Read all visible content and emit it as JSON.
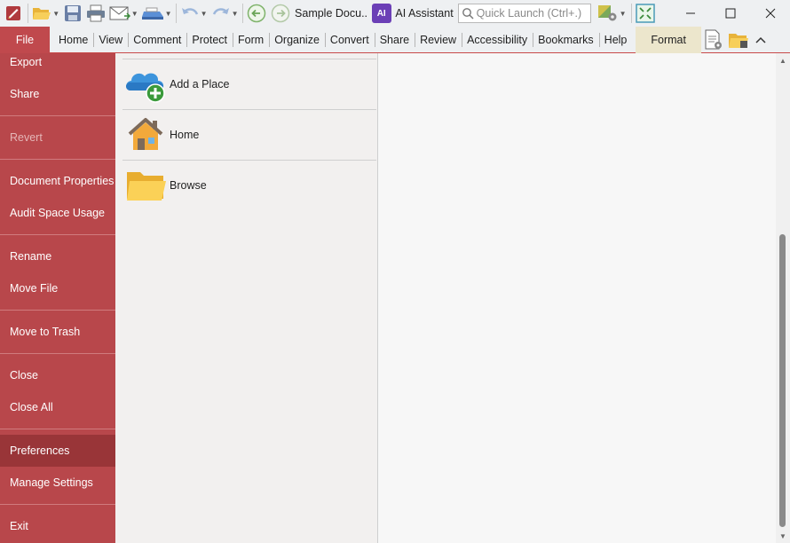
{
  "titlebar": {
    "document_title": "Sample Docu..",
    "ai_assistant_label": "AI Assistant",
    "ai_icon_text": "AI",
    "quick_launch_placeholder": "Quick Launch (Ctrl+.)",
    "icons": [
      "app-logo-icon",
      "open-folder-icon",
      "save-icon",
      "print-icon",
      "email-icon",
      "scan-icon",
      "undo-icon",
      "redo-icon",
      "back-icon",
      "forward-icon",
      "ai-assistant-icon",
      "search-icon",
      "theme-settings-icon",
      "fullscreen-icon",
      "minimize-icon",
      "maximize-icon",
      "close-icon"
    ]
  },
  "ribbon": {
    "file_tab": "File",
    "tabs": [
      "Home",
      "View",
      "Comment",
      "Protect",
      "Form",
      "Organize",
      "Convert",
      "Share",
      "Review",
      "Accessibility",
      "Bookmarks",
      "Help"
    ],
    "format_tab": "Format",
    "right_icons": [
      "document-properties-icon",
      "open-folder-icon",
      "collapse-ribbon-icon"
    ]
  },
  "backstage_nav": {
    "items": [
      {
        "label": "Export",
        "enabled": true
      },
      {
        "label": "Share",
        "enabled": true
      },
      {
        "label": "Revert",
        "enabled": false
      },
      {
        "label": "Document Properties",
        "enabled": true
      },
      {
        "label": "Audit Space Usage",
        "enabled": true
      },
      {
        "label": "Rename",
        "enabled": true
      },
      {
        "label": "Move File",
        "enabled": true
      },
      {
        "label": "Move to Trash",
        "enabled": true
      },
      {
        "label": "Close",
        "enabled": true
      },
      {
        "label": "Close All",
        "enabled": true
      },
      {
        "label": "Preferences",
        "enabled": true,
        "selected": true
      },
      {
        "label": "Manage Settings",
        "enabled": true
      },
      {
        "label": "Exit",
        "enabled": true
      }
    ]
  },
  "places": {
    "items": [
      {
        "label": "Add a Place",
        "icon": "cloud-add-icon"
      },
      {
        "label": "Home",
        "icon": "home-icon"
      },
      {
        "label": "Browse",
        "icon": "folder-icon"
      }
    ]
  },
  "colors": {
    "nav_background": "#b8474b",
    "nav_selected": "#993538",
    "format_tab": "#ece6cc",
    "ai_accent": "#6b3fb6"
  }
}
